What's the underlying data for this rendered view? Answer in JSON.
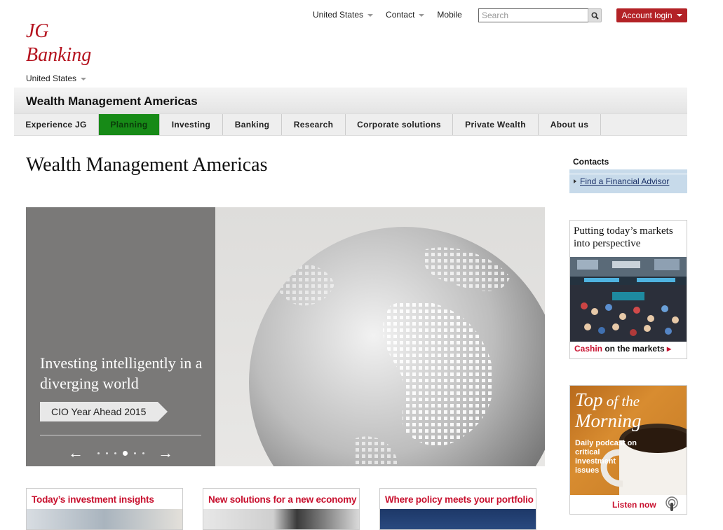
{
  "logo": {
    "line1": "JG",
    "line2": "Banking"
  },
  "region": {
    "label": "United States"
  },
  "topnav": {
    "country": "United States",
    "contact": "Contact",
    "mobile": "Mobile",
    "search_placeholder": "Search",
    "account_login": "Account login"
  },
  "section": {
    "title": "Wealth Management Americas"
  },
  "mainnav": {
    "tabs": [
      {
        "label": "Experience JG"
      },
      {
        "label": "Planning"
      },
      {
        "label": "Investing"
      },
      {
        "label": "Banking"
      },
      {
        "label": "Research"
      },
      {
        "label": "Corporate solutions"
      },
      {
        "label": "Private Wealth"
      },
      {
        "label": "About us"
      }
    ],
    "active": "Planning"
  },
  "page": {
    "title": "Wealth Management Americas"
  },
  "hero": {
    "heading": "Investing intelligently in a diverging world",
    "cta": "CIO Year Ahead 2015",
    "slides": 5,
    "active_slide": 3
  },
  "sidebar": {
    "contacts_heading": "Contacts",
    "find_advisor": "Find a Financial Advisor",
    "promo1": {
      "heading": "Putting today’s markets into perspective",
      "footer_red": "Cashin",
      "footer_rest": " on the markets ",
      "footer_arrow": "▸"
    },
    "promo2": {
      "title_top": "Top",
      "title_of": " of the",
      "title_morning": "Morning",
      "sub": "Daily podcast on critical investment issues",
      "listen": "Listen now"
    }
  },
  "cards": [
    {
      "title": "Today’s investment insights"
    },
    {
      "title": "New solutions for a new economy"
    },
    {
      "title": "Where policy meets your portfolio"
    }
  ],
  "colors": {
    "brand_red": "#b4111d",
    "login_bg": "#b32226",
    "active_tab": "#178a17",
    "contacts_bg": "#c7daea"
  }
}
